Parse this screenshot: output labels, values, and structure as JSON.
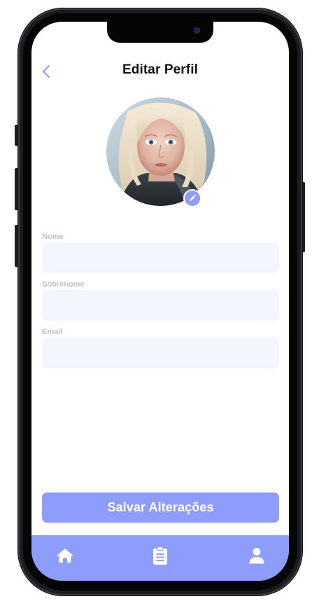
{
  "header": {
    "title": "Editar Perfil",
    "back_icon": "chevron-left-icon"
  },
  "profile": {
    "edit_icon": "pencil-icon"
  },
  "form": {
    "first_name": {
      "label": "Nome",
      "value": "",
      "placeholder": ""
    },
    "last_name": {
      "label": "Sobrenome",
      "value": "",
      "placeholder": ""
    },
    "email": {
      "label": "Email",
      "value": "",
      "placeholder": ""
    }
  },
  "actions": {
    "save_label": "Salvar Alterações"
  },
  "bottom_nav": {
    "items": [
      {
        "id": "home",
        "icon": "home-icon"
      },
      {
        "id": "orders",
        "icon": "clipboard-icon"
      },
      {
        "id": "profile",
        "icon": "user-icon"
      }
    ]
  },
  "colors": {
    "accent": "#8E9DFB",
    "input_bg": "#F3F5FF",
    "label": "#BFC0C7",
    "title": "#111111",
    "back_icon": "#8E9DFB"
  }
}
